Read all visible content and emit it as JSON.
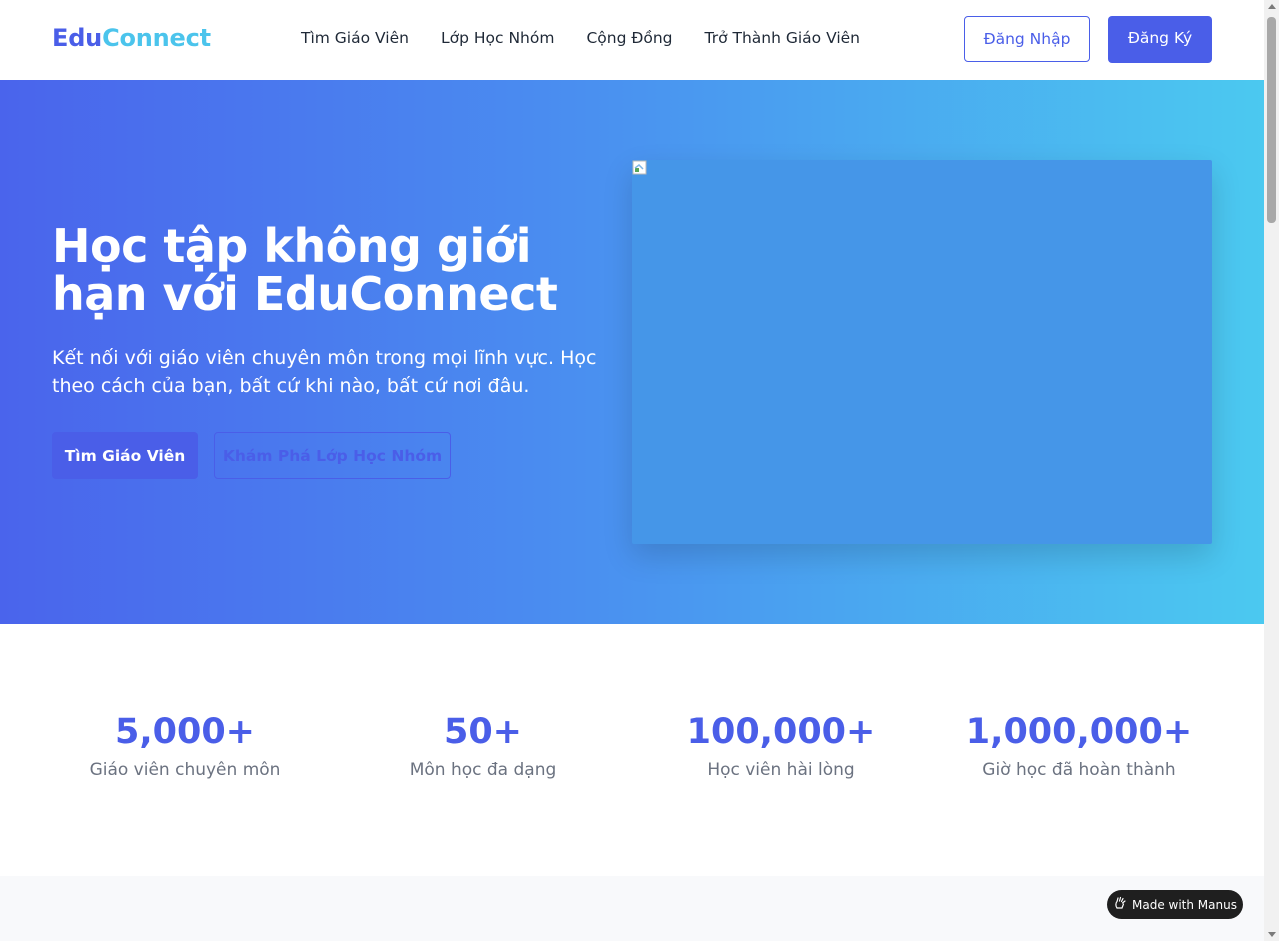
{
  "brand": {
    "part1": "Edu",
    "part2": "Connect"
  },
  "nav": {
    "items": [
      {
        "label": "Tìm Giáo Viên"
      },
      {
        "label": "Lớp Học Nhóm"
      },
      {
        "label": "Cộng Đồng"
      },
      {
        "label": "Trở Thành Giáo Viên"
      }
    ]
  },
  "auth": {
    "login_label": "Đăng Nhập",
    "register_label": "Đăng Ký"
  },
  "hero": {
    "title": "Học tập không giới hạn với EduConnect",
    "subtitle": "Kết nối với giáo viên chuyên môn trong mọi lĩnh vực. Học theo cách của bạn, bất cứ khi nào, bất cứ nơi đâu.",
    "primary_cta": "Tìm Giáo Viên",
    "secondary_cta": "Khám Phá Lớp Học Nhóm",
    "image_icon": "broken-image-icon"
  },
  "stats": [
    {
      "value": "5,000+",
      "label": "Giáo viên chuyên môn"
    },
    {
      "value": "50+",
      "label": "Môn học đa dạng"
    },
    {
      "value": "100,000+",
      "label": "Học viên hài lòng"
    },
    {
      "value": "1,000,000+",
      "label": "Giờ học đã hoàn thành"
    }
  ],
  "badge": {
    "label": "Made with Manus",
    "icon": "manus-hand-icon"
  },
  "colors": {
    "primary": "#4a5ee8",
    "accent": "#4bc4ec",
    "gradient_start": "#4a64ec",
    "gradient_end": "#4bc9f0"
  }
}
